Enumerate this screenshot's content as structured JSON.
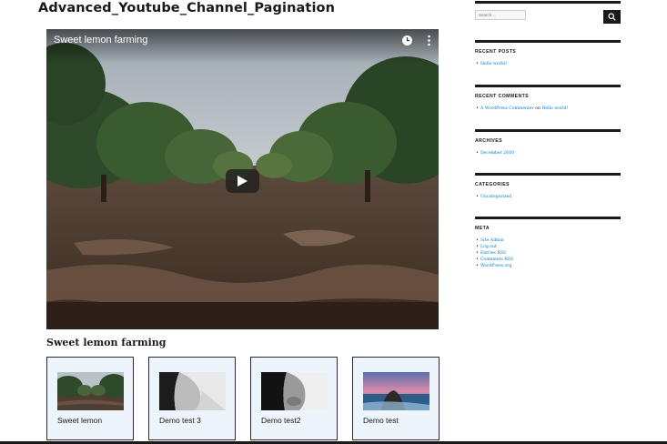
{
  "page": {
    "title": "Advanced_Youtube_Channel_Pagination"
  },
  "player": {
    "video_title": "Sweet lemon farming",
    "clock_icon": "clock-icon",
    "more_icon": "more-vert-icon",
    "play_icon": "play-icon"
  },
  "video_heading": "Sweet lemon farming",
  "thumbnails": [
    {
      "label": "Sweet lemon",
      "image": "lemon-orchard"
    },
    {
      "label": "Demo test 3",
      "image": "woman-profile"
    },
    {
      "label": "Demo test2",
      "image": "woman-bw-portrait"
    },
    {
      "label": "Demo test",
      "image": "seascape-sunset"
    }
  ],
  "sidebar": {
    "search": {
      "placeholder": "Search ...",
      "button_icon": "search-icon"
    },
    "recent_posts": {
      "title": "RECENT POSTS",
      "items": [
        "Hello world!"
      ]
    },
    "recent_comments": {
      "title": "RECENT COMMENTS",
      "author": "A WordPress Commenter",
      "connector": "on",
      "post": "Hello world!"
    },
    "archives": {
      "title": "ARCHIVES",
      "items": [
        "December 2016"
      ]
    },
    "categories": {
      "title": "CATEGORIES",
      "items": [
        "Uncategorized"
      ]
    },
    "meta": {
      "title": "META",
      "items": [
        "Site Admin",
        "Log out",
        "Entries RSS",
        "Comments RSS",
        "WordPress.org"
      ]
    }
  },
  "colors": {
    "link": "#007acc",
    "text": "#1a1a1a",
    "card_bg": "#eef4fb"
  }
}
